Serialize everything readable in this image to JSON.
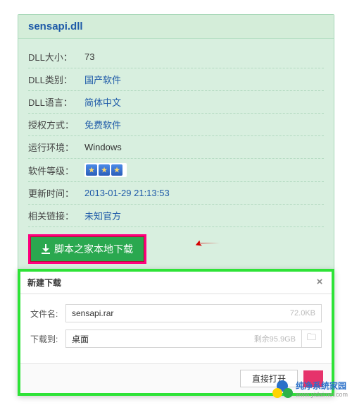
{
  "title": "sensapi.dll",
  "labels": {
    "size": "DLL大小：",
    "category": "DLL类别：",
    "language": "DLL语言：",
    "license": "授权方式：",
    "runtime": "运行环境：",
    "rating": "软件等级：",
    "updated": "更新时间：",
    "related": "相关链接："
  },
  "values": {
    "size": "73",
    "category": "国产软件",
    "language": "简体中文",
    "license": "免费软件",
    "runtime": "Windows",
    "updated": "2013-01-29 21:13:53",
    "related": "未知官方"
  },
  "rating_stars": 3,
  "download_button": "脚本之家本地下载",
  "dialog": {
    "title": "新建下载",
    "filename_label": "文件名:",
    "filename_value": "sensapi.rar",
    "filesize": "72.0KB",
    "saveto_label": "下载到:",
    "saveto_value": "桌面",
    "remaining": "剩余95.9GB",
    "open_btn": "直接打开",
    "close": "×",
    "folder_icon": "folder-icon"
  },
  "watermark": {
    "cn": "纯净系统家园",
    "url": "www.yidaimei.com"
  },
  "colors": {
    "card_bg": "#d4edd9",
    "link": "#1e5aa8",
    "download_green": "#2aa84f",
    "highlight_pink": "#ff007f",
    "dialog_border": "#2ee337"
  }
}
